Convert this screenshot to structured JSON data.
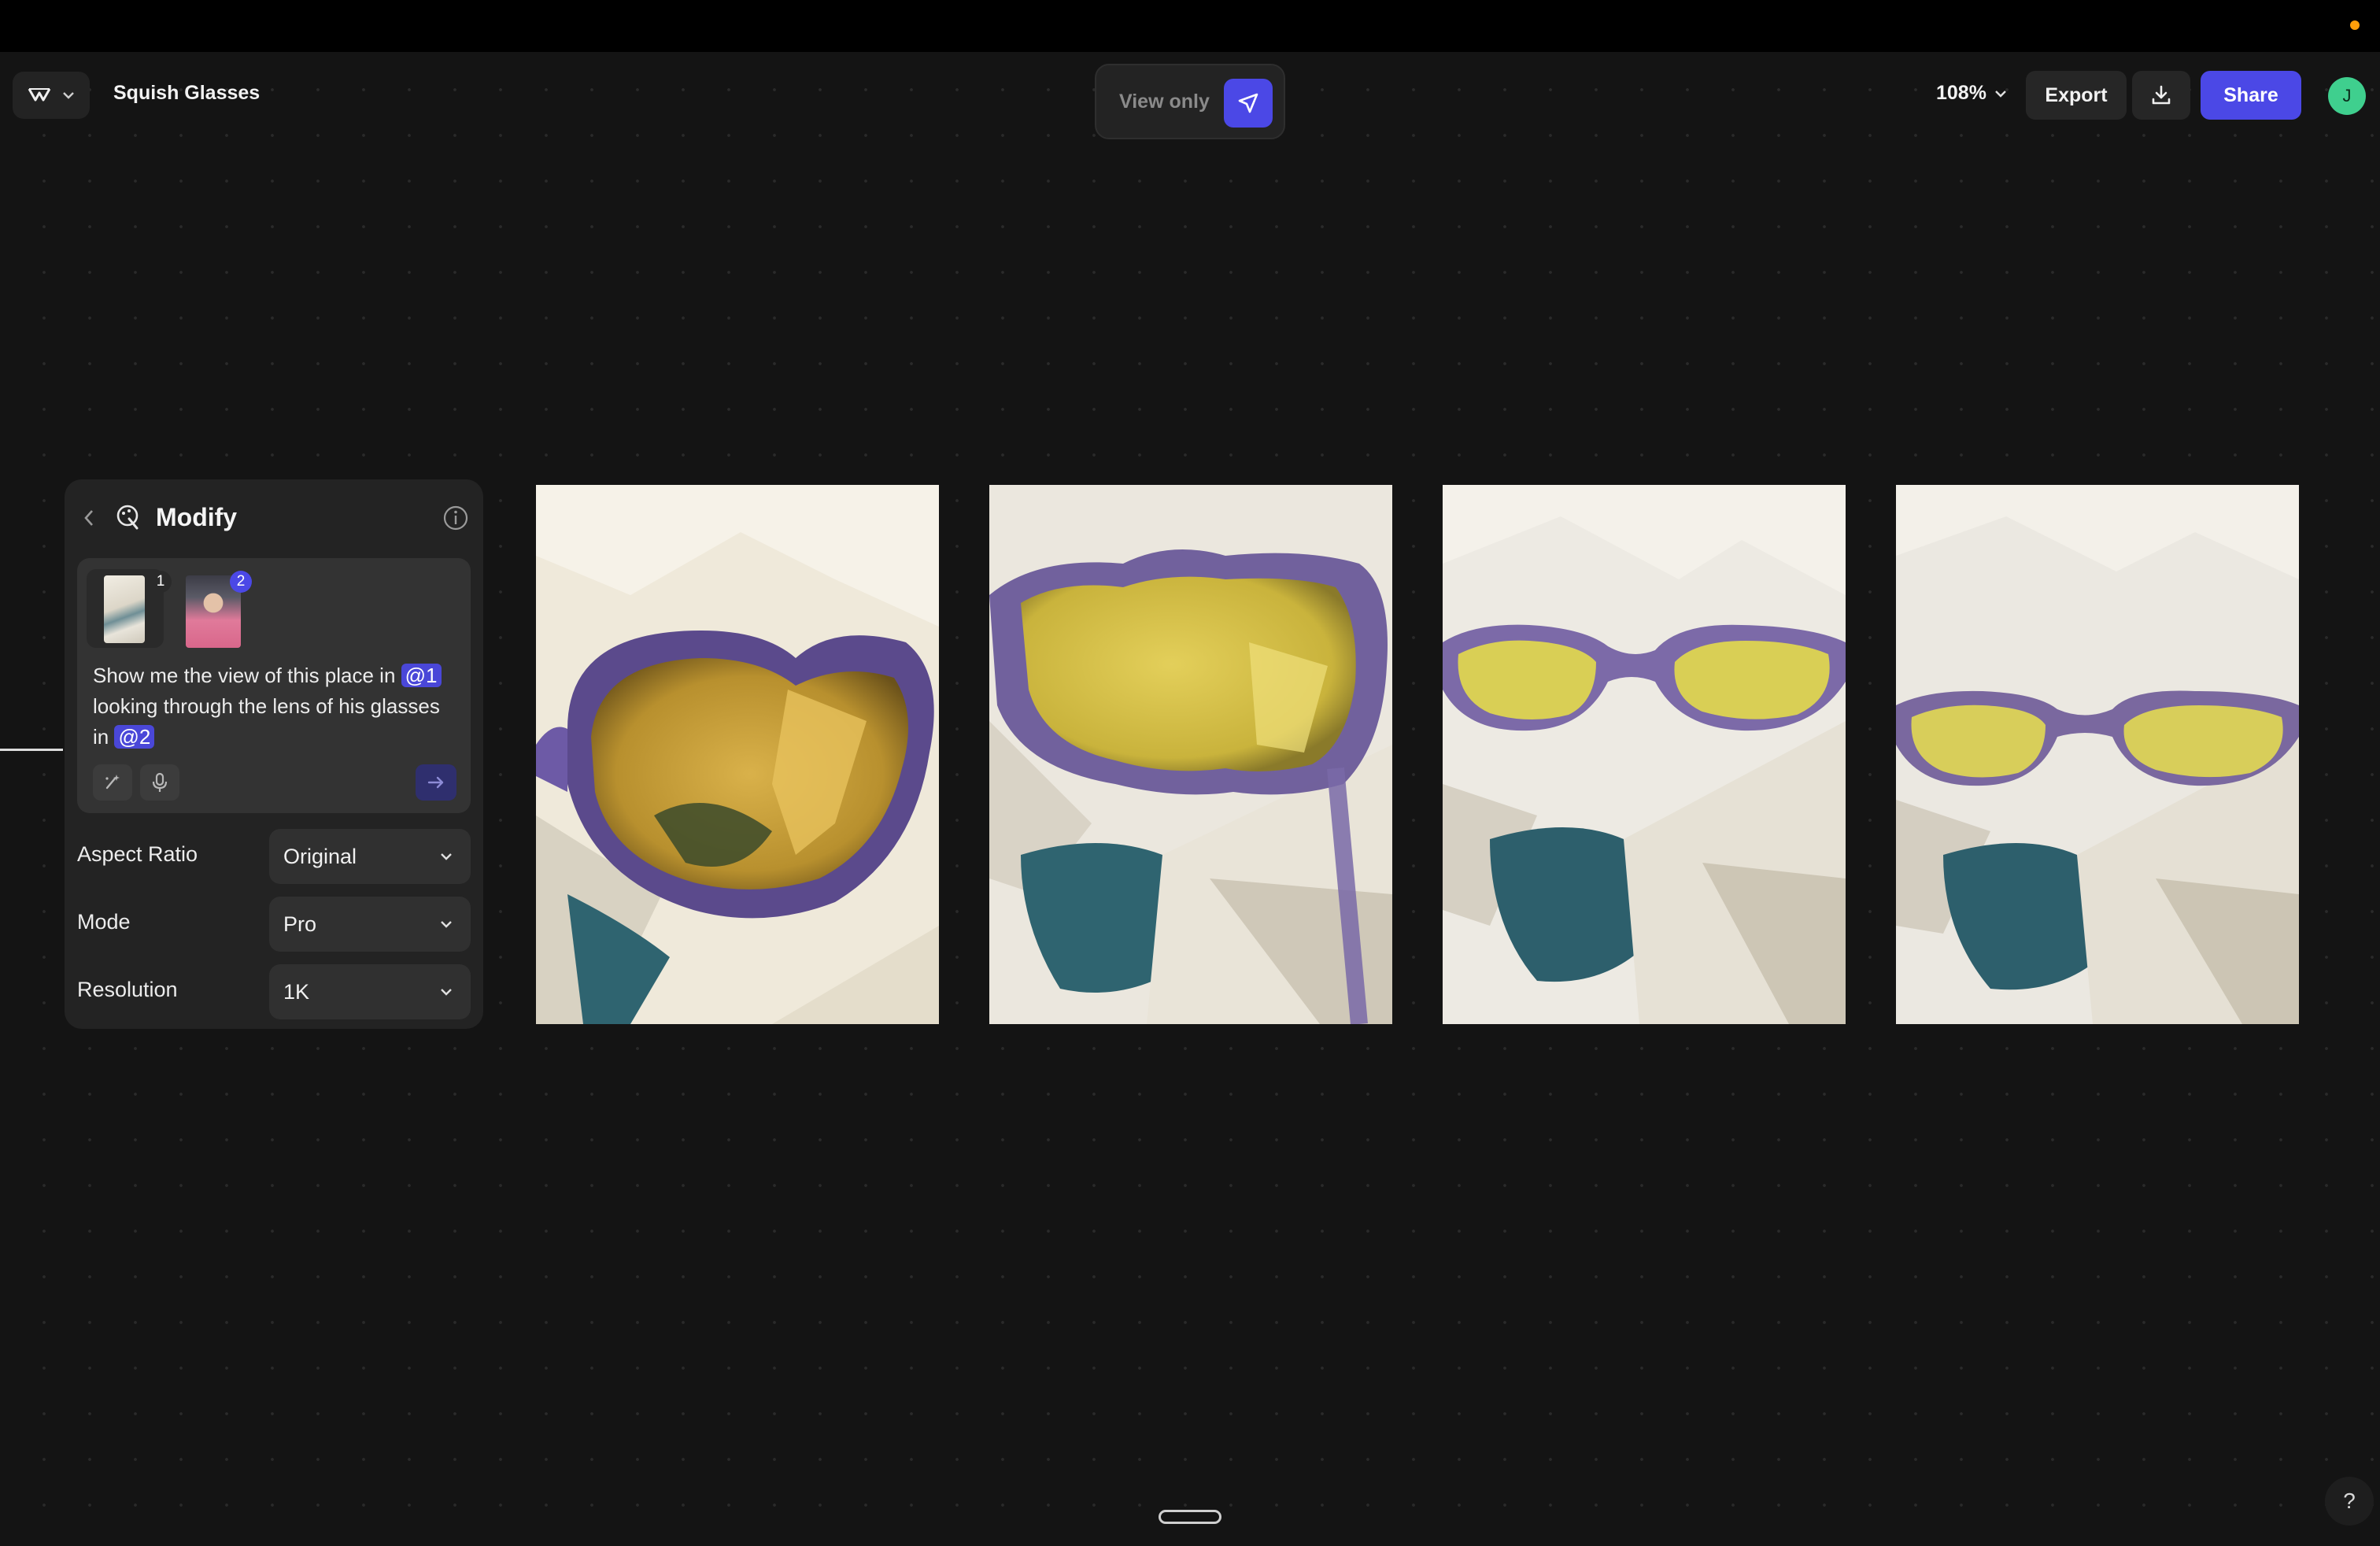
{
  "document": {
    "title": "Squish Glasses"
  },
  "mode": {
    "label": "View only",
    "pointer_icon": "cursor-arrow-icon"
  },
  "toolbar": {
    "zoom": "108%",
    "export_label": "Export",
    "download_icon": "download-icon",
    "share_label": "Share",
    "avatar_initial": "J"
  },
  "panel": {
    "title": "Modify",
    "thumbnails": [
      {
        "badge": "1",
        "subject": "white rock canyon photo"
      },
      {
        "badge": "2",
        "subject": "man in pink shirt with glasses"
      }
    ],
    "prompt": {
      "part1": "Show me the view of this place in",
      "mention1": "@1",
      "part2": "looking through the lens of his glasses in",
      "mention2": "@2"
    },
    "settings": [
      {
        "label": "Aspect Ratio",
        "value": "Original"
      },
      {
        "label": "Mode",
        "value": "Pro"
      },
      {
        "label": "Resolution",
        "value": "1K"
      }
    ]
  },
  "gallery": [
    {
      "subject": "close-up through purple sunglasses with yellow lens"
    },
    {
      "subject": "blurred purple sunglasses in foreground over white canyon"
    },
    {
      "subject": "purple sunglasses with yellow lenses over white canyon"
    },
    {
      "subject": "purple sunglasses with yellow lenses over white canyon and water"
    }
  ],
  "help": {
    "label": "?"
  },
  "colors": {
    "accent": "#4b48e6",
    "avatar": "#3fcf8e",
    "notification": "#ff9f0a",
    "mention": "#4a47d8"
  }
}
